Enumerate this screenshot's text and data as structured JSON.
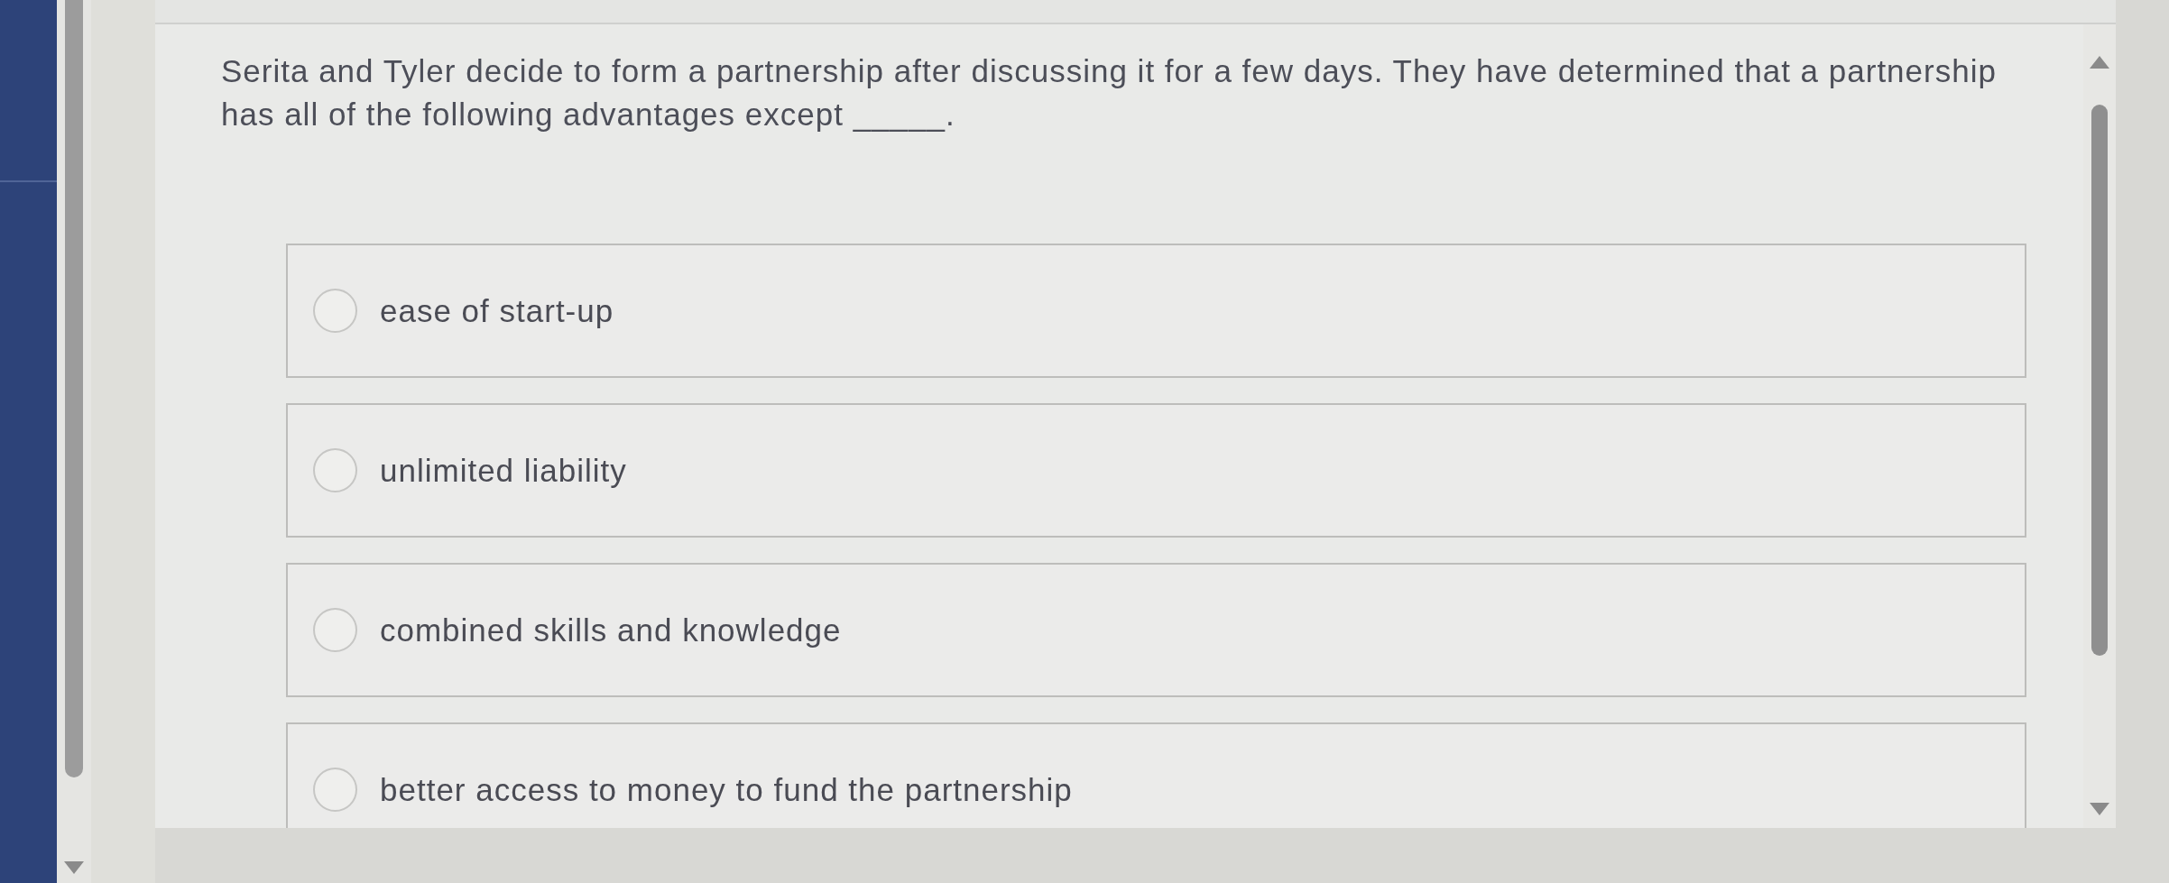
{
  "question": {
    "text": "Serita and Tyler decide to form a partnership after discussing it for a few days. They have determined that a partnership has all of the following advantages except _____."
  },
  "options": [
    {
      "label": "ease of start-up",
      "selected": false
    },
    {
      "label": "unlimited liability",
      "selected": false
    },
    {
      "label": "combined skills and knowledge",
      "selected": false
    },
    {
      "label": "better access to money to fund the partnership",
      "selected": false
    }
  ]
}
